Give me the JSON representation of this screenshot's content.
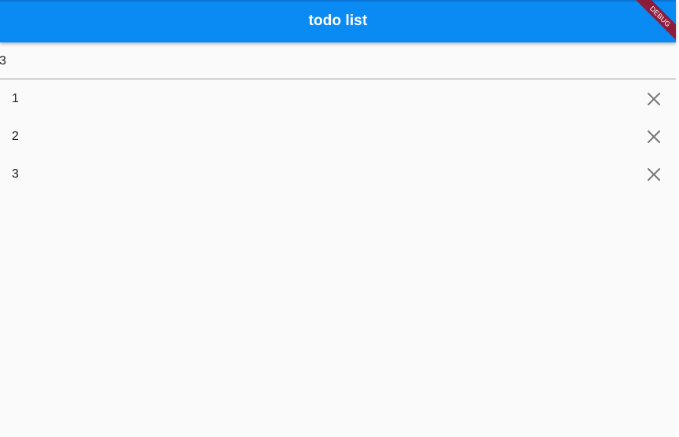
{
  "appbar": {
    "title": "todo list"
  },
  "debug_banner": {
    "label": "DEBUG"
  },
  "input": {
    "value": "3",
    "placeholder": ""
  },
  "todos": [
    {
      "label": "1"
    },
    {
      "label": "2"
    },
    {
      "label": "3"
    }
  ],
  "colors": {
    "appbar": "#0a8af3",
    "background": "#fafafa",
    "debug_banner": "#8c1c3a",
    "delete_icon": "#757575"
  },
  "icons": {
    "delete": "close-icon"
  }
}
